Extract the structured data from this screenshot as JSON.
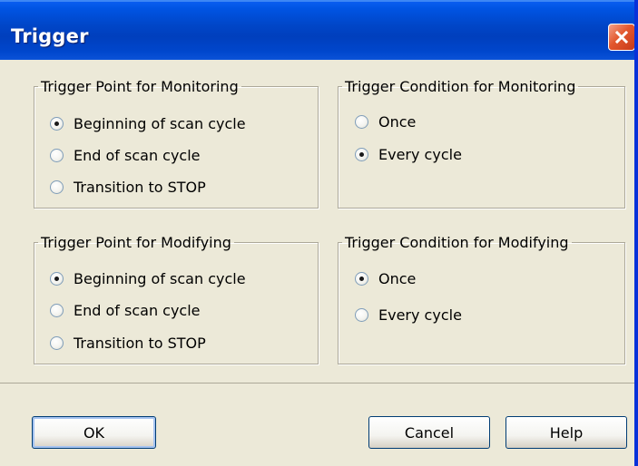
{
  "window": {
    "title": "Trigger"
  },
  "groups": {
    "monitoring_point": {
      "legend": "Trigger Point for Monitoring",
      "options": [
        "Beginning of scan cycle",
        "End of scan cycle",
        "Transition to STOP"
      ],
      "selected": 0
    },
    "monitoring_condition": {
      "legend": "Trigger Condition for Monitoring",
      "options": [
        "Once",
        "Every cycle"
      ],
      "selected": 1
    },
    "modifying_point": {
      "legend": "Trigger Point for Modifying",
      "options": [
        "Beginning of scan cycle",
        "End of scan cycle",
        "Transition to STOP"
      ],
      "selected": 0
    },
    "modifying_condition": {
      "legend": "Trigger Condition for Modifying",
      "options": [
        "Once",
        "Every cycle"
      ],
      "selected": 0
    }
  },
  "buttons": {
    "ok": "OK",
    "cancel": "Cancel",
    "help": "Help"
  },
  "colors": {
    "title_bar": "#0054e3",
    "dialog_background": "#ece9d8",
    "close_button": "#e2572e"
  },
  "icons": {
    "close": "close-icon"
  }
}
